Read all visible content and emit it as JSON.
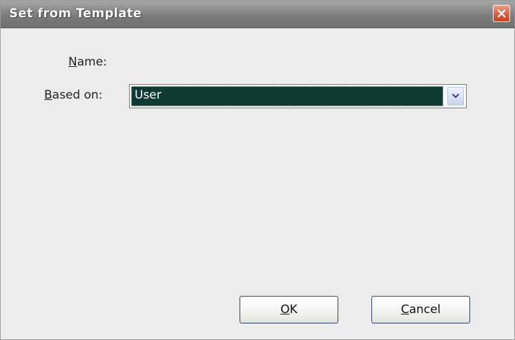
{
  "dialog": {
    "title": "Set from Template",
    "close_label": "✕"
  },
  "form": {
    "name_label_accel": "N",
    "name_label_rest": "ame:",
    "based_on_label_accel": "B",
    "based_on_label_rest": "ased on:",
    "based_on_value": "User"
  },
  "buttons": {
    "ok_accel": "O",
    "ok_rest": "K",
    "cancel_accel": "C",
    "cancel_rest": "ancel"
  },
  "colors": {
    "titlebar": "#7c7c7c",
    "dialog_bg": "#ececec",
    "close_button": "#dd5a3a",
    "combo_selection": "#0f3a36",
    "button_border": "#2c3f6f"
  },
  "icons": {
    "close": "close-icon",
    "dropdown": "chevron-down-icon"
  }
}
